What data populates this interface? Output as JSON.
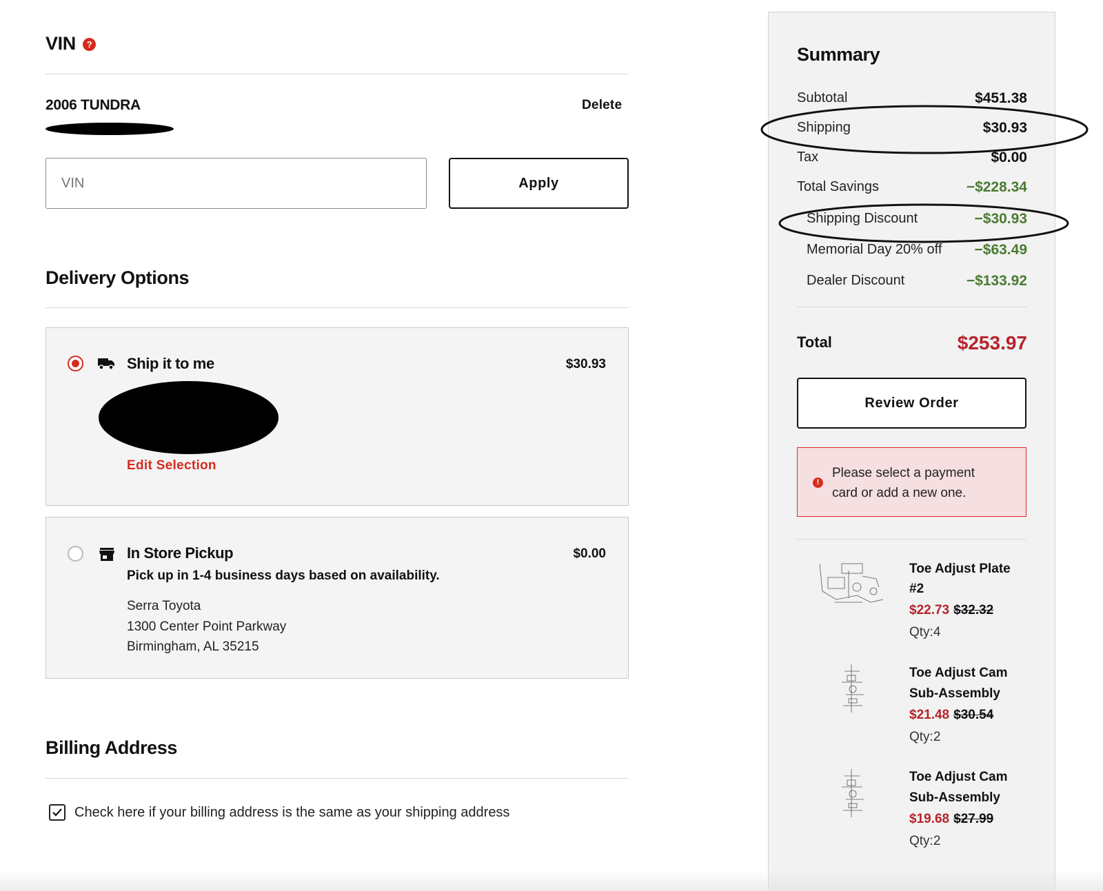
{
  "vin_section": {
    "title": "VIN",
    "help_icon": "question-circle-icon",
    "help_glyph": "?",
    "vehicle": "2006 TUNDRA",
    "delete_label": "Delete",
    "vin_placeholder": "VIN",
    "apply_label": "Apply"
  },
  "delivery": {
    "title": "Delivery Options",
    "options": [
      {
        "icon": "truck-icon",
        "title": "Ship it to me",
        "price": "$30.93",
        "selected": true,
        "edit_label": "Edit Selection"
      },
      {
        "icon": "store-icon",
        "title": "In Store Pickup",
        "price": "$0.00",
        "selected": false,
        "note": "Pick up in 1-4 business days based on availability.",
        "store_name": "Serra Toyota",
        "store_street": "1300 Center Point Parkway",
        "store_city": "Birmingham, AL 35215"
      }
    ]
  },
  "billing": {
    "title": "Billing Address",
    "same_as_shipping_label": "Check here if your billing address is the same as your shipping address",
    "same_as_shipping_checked": true
  },
  "summary": {
    "title": "Summary",
    "subtotal_label": "Subtotal",
    "subtotal": "$451.38",
    "shipping_label": "Shipping",
    "shipping": "$30.93",
    "tax_label": "Tax",
    "tax": "$0.00",
    "total_savings_label": "Total Savings",
    "total_savings": "−$228.34",
    "discounts": [
      {
        "label": "Shipping Discount",
        "value": "−$30.93"
      },
      {
        "label": "Memorial Day 20% off",
        "value": "−$63.49"
      },
      {
        "label": "Dealer Discount",
        "value": "−$133.92"
      }
    ],
    "total_label": "Total",
    "total": "$253.97",
    "review_label": "Review Order",
    "alert_icon": "alert-circle-icon",
    "alert_glyph": "!",
    "alert_line1": "Please select a payment",
    "alert_line2": "card or add a new one.",
    "items": [
      {
        "name_line1": "Toe Adjust Plate",
        "name_line2": "#2",
        "price": "$22.73",
        "was": "$32.32",
        "qty": "Qty:4"
      },
      {
        "name_line1": "Toe Adjust Cam",
        "name_line2": "Sub-Assembly",
        "price": "$21.48",
        "was": "$30.54",
        "qty": "Qty:2"
      },
      {
        "name_line1": "Toe Adjust Cam",
        "name_line2": "Sub-Assembly",
        "price": "$19.68",
        "was": "$27.99",
        "qty": "Qty:2"
      }
    ]
  },
  "colors": {
    "accent_red": "#d52b1e",
    "price_red": "#b5232a",
    "savings_green": "#4a7a32"
  }
}
